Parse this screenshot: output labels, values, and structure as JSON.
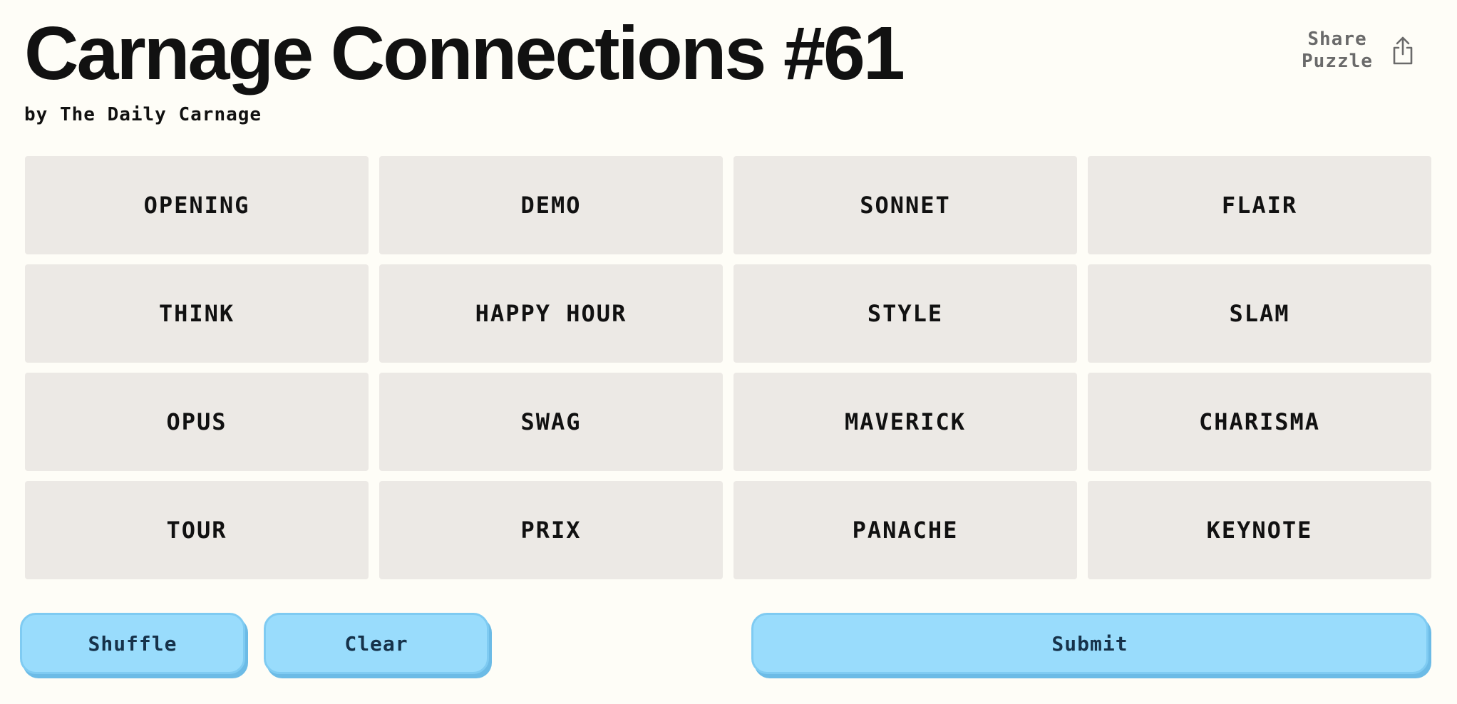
{
  "header": {
    "title": "Carnage Connections #61",
    "byline": "by The Daily Carnage",
    "share_label": "Share Puzzle",
    "share_icon": "share-icon"
  },
  "board": {
    "tiles": [
      "OPENING",
      "DEMO",
      "SONNET",
      "FLAIR",
      "THINK",
      "HAPPY HOUR",
      "STYLE",
      "SLAM",
      "OPUS",
      "SWAG",
      "MAVERICK",
      "CHARISMA",
      "TOUR",
      "PRIX",
      "PANACHE",
      "KEYNOTE"
    ]
  },
  "controls": {
    "shuffle_label": "Shuffle",
    "clear_label": "Clear",
    "submit_label": "Submit"
  },
  "colors": {
    "background": "#fefdf7",
    "tile": "#ece9e5",
    "button": "#99dcfc",
    "button_shadow": "#6cbbe6",
    "text": "#111111"
  }
}
